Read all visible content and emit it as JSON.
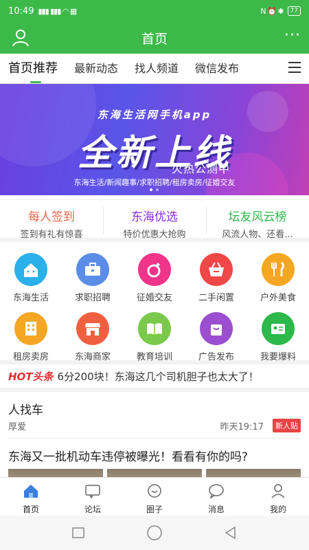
{
  "status": {
    "time": "10:49",
    "signal": "5G 4G",
    "wifi": "wifi",
    "battery": "77"
  },
  "header": {
    "title": "首页"
  },
  "tabs": [
    {
      "label": "首页推荐",
      "active": true
    },
    {
      "label": "最新动态"
    },
    {
      "label": "找人频道"
    },
    {
      "label": "微信发布"
    }
  ],
  "banner": {
    "subtitle": "东海生活网手机app",
    "title": "全新上线",
    "testing": "火热公测中",
    "tags": "东海生活/新闻趣事/求职招聘/租房卖房/征婚交友"
  },
  "quick": [
    {
      "title": "每人签到",
      "desc": "签到有礼有惊喜",
      "color": "#e8664a"
    },
    {
      "title": "东海优选",
      "desc": "特价优惠大抢购",
      "color": "#8a2be2"
    },
    {
      "title": "坛友风云榜",
      "desc": "风流人物、还看...",
      "color": "#2cb84a"
    }
  ],
  "grid": [
    {
      "label": "东海生活",
      "icon": "house-icon",
      "color": "#2ab0ea"
    },
    {
      "label": "求职招聘",
      "icon": "briefcase-icon",
      "color": "#5b8de8"
    },
    {
      "label": "征婚交友",
      "icon": "ring-icon",
      "color": "#f0348a"
    },
    {
      "label": "二手闲置",
      "icon": "basket-icon",
      "color": "#f04848"
    },
    {
      "label": "户外美食",
      "icon": "fork-knife-icon",
      "color": "#f5a623"
    },
    {
      "label": "租房卖房",
      "icon": "building-icon",
      "color": "#f5a623"
    },
    {
      "label": "东海商家",
      "icon": "store-icon",
      "color": "#f06040"
    },
    {
      "label": "教育培训",
      "icon": "book-icon",
      "color": "#7ac94a"
    },
    {
      "label": "广告发布",
      "icon": "bag-icon",
      "color": "#9b4fd0"
    },
    {
      "label": "我要爆料",
      "icon": "id-card-icon",
      "color": "#2cb84a"
    }
  ],
  "hot": {
    "logo": "HOT头条",
    "text": "6分200块！东海这几个司机胆子也太大了！"
  },
  "posts": [
    {
      "title": "人找车",
      "author": "厚爱",
      "time": "昨天19:17",
      "badge": "新人贴"
    },
    {
      "title": "东海又一批机动车违停被曝光！看看有你的吗?"
    }
  ],
  "tabbar": [
    {
      "label": "首页",
      "icon": "home-icon",
      "active": true
    },
    {
      "label": "论坛",
      "icon": "forum-icon"
    },
    {
      "label": "圈子",
      "icon": "circle-chat-icon"
    },
    {
      "label": "消息",
      "icon": "message-icon"
    },
    {
      "label": "我的",
      "icon": "profile-icon"
    }
  ],
  "colors": {
    "brand": "#3db94a",
    "hot": "#e63030"
  }
}
